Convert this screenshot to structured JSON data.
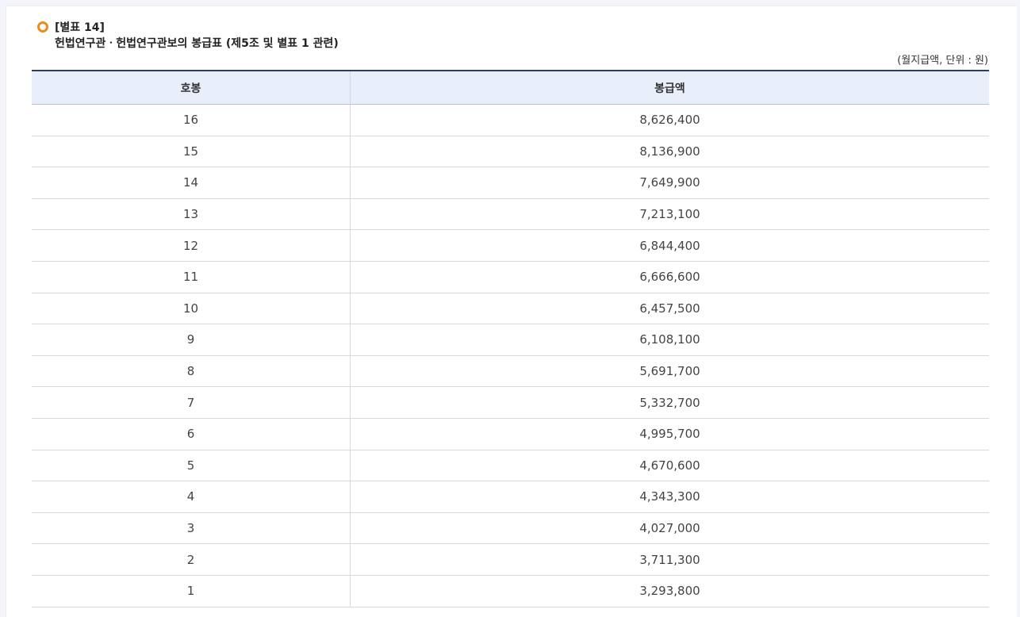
{
  "heading": {
    "label": "[별표 14]",
    "title": "헌법연구관ㆍ헌법연구관보의 봉급표 (제5조 및 별표 1 관련)"
  },
  "unit_note": "(월지급액, 단위 : 원)",
  "table": {
    "headers": [
      "호봉",
      "봉급액"
    ],
    "rows": [
      {
        "step": "16",
        "amount": "8,626,400"
      },
      {
        "step": "15",
        "amount": "8,136,900"
      },
      {
        "step": "14",
        "amount": "7,649,900"
      },
      {
        "step": "13",
        "amount": "7,213,100"
      },
      {
        "step": "12",
        "amount": "6,844,400"
      },
      {
        "step": "11",
        "amount": "6,666,600"
      },
      {
        "step": "10",
        "amount": "6,457,500"
      },
      {
        "step": "9",
        "amount": "6,108,100"
      },
      {
        "step": "8",
        "amount": "5,691,700"
      },
      {
        "step": "7",
        "amount": "5,332,700"
      },
      {
        "step": "6",
        "amount": "4,995,700"
      },
      {
        "step": "5",
        "amount": "4,670,600"
      },
      {
        "step": "4",
        "amount": "4,343,300"
      },
      {
        "step": "3",
        "amount": "4,027,000"
      },
      {
        "step": "2",
        "amount": "3,711,300"
      },
      {
        "step": "1",
        "amount": "3,293,800"
      }
    ]
  },
  "colors": {
    "accent": "#f18a1c",
    "header_bg": "#e8eefa",
    "table_top_border": "#2c3e5c"
  }
}
